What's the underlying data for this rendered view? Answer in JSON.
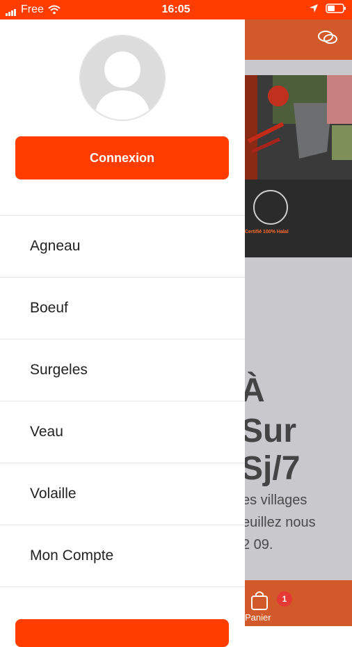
{
  "status_bar": {
    "carrier": "Free",
    "time": "16:05"
  },
  "background_screen": {
    "certification_text": "Certifié 100% Halal",
    "headline_lines": [
      "À",
      "Sur",
      "Sj/7"
    ],
    "body_lines": [
      "es villages",
      "euillez nous",
      "2 09."
    ],
    "cart_badge": "1",
    "cart_label": "Panier"
  },
  "drawer": {
    "login_button": "Connexion",
    "menu_items": [
      "Agneau",
      "Boeuf",
      "Surgeles",
      "Veau",
      "Volaille",
      "Mon Compte"
    ]
  },
  "colors": {
    "accent": "#ff3d00",
    "header_dimmed": "#d25a2a"
  }
}
